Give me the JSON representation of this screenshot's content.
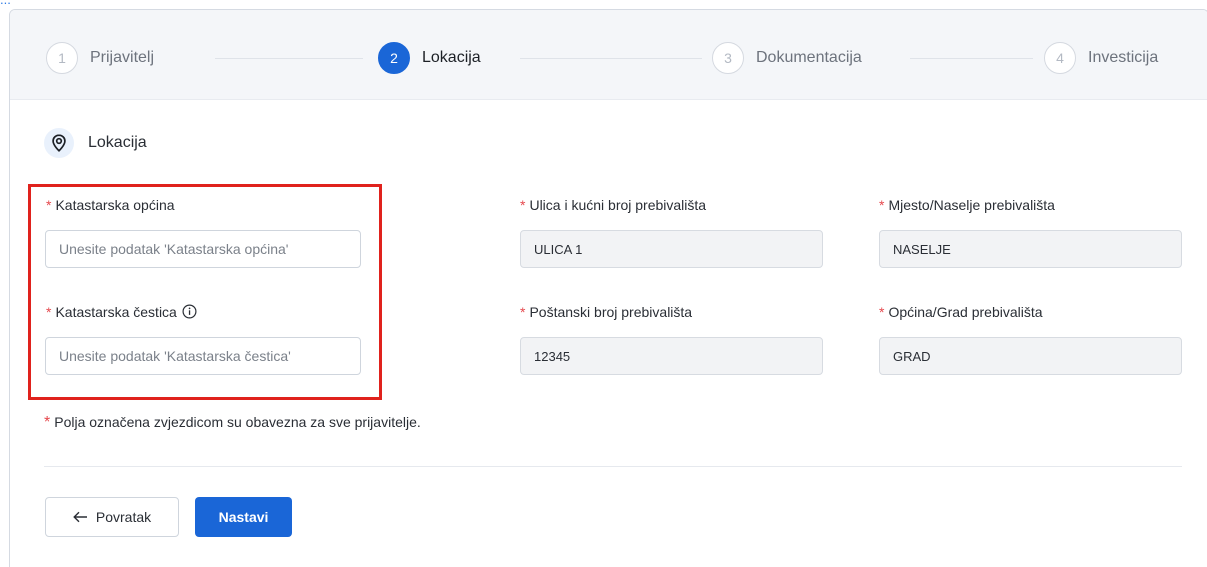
{
  "header_fragment": "...",
  "stepper": {
    "steps": [
      {
        "num": "1",
        "label": "Prijavitelj"
      },
      {
        "num": "2",
        "label": "Lokacija"
      },
      {
        "num": "3",
        "label": "Dokumentacija"
      },
      {
        "num": "4",
        "label": "Investicija"
      }
    ],
    "active_step": 2
  },
  "section": {
    "title": "Lokacija",
    "icon": "location-pin-icon"
  },
  "fields": {
    "katastarska_opcina": {
      "required_mark": "*",
      "label": "Katastarska općina",
      "value": "",
      "placeholder": "Unesite podatak 'Katastarska općina'"
    },
    "katastarska_cestica": {
      "required_mark": "*",
      "label": "Katastarska čestica",
      "value": "",
      "placeholder": "Unesite podatak 'Katastarska čestica'"
    },
    "ulica": {
      "required_mark": "*",
      "label": "Ulica i kućni broj prebivališta",
      "value": "ULICA 1"
    },
    "postanski_broj": {
      "required_mark": "*",
      "label": "Poštanski broj prebivališta",
      "value": "12345"
    },
    "mjesto": {
      "required_mark": "*",
      "label": "Mjesto/Naselje prebivališta",
      "value": "NASELJE"
    },
    "opcina_grad": {
      "required_mark": "*",
      "label": "Općina/Grad prebivališta",
      "value": "GRAD"
    }
  },
  "required_note": {
    "mark": "*",
    "text": "Polja označena zvjezdicom su obavezna za sve prijavitelje."
  },
  "buttons": {
    "back": "Povratak",
    "next": "Nastavi"
  },
  "colors": {
    "accent": "#1a66d7",
    "required": "#e5484d",
    "highlight": "#e0221d"
  }
}
